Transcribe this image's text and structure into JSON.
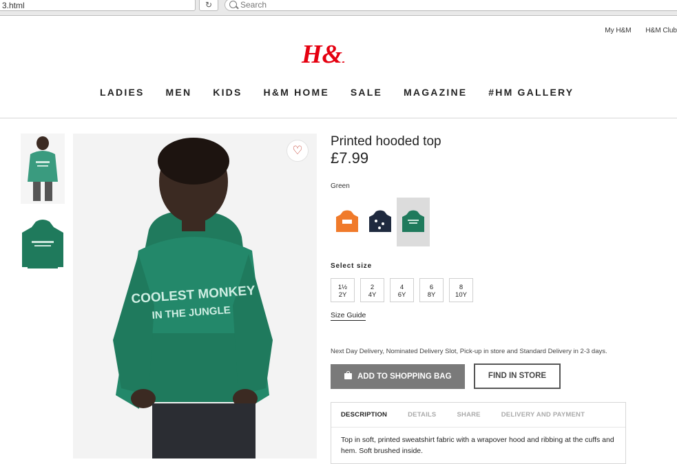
{
  "browser": {
    "url": "3.html",
    "search_placeholder": "Search",
    "reload_glyph": "↻"
  },
  "header": {
    "top_links": [
      "My H&M",
      "H&M Club"
    ],
    "brand": "H&M",
    "brand_color": "#e50010",
    "nav": [
      "LADIES",
      "MEN",
      "KIDS",
      "H&M HOME",
      "SALE",
      "MAGAZINE",
      "#HM GALLERY"
    ]
  },
  "product": {
    "title": "Printed hooded top",
    "price": "£7.99",
    "color_name": "Green",
    "print_text_line1": "COOLEST MONKEY",
    "print_text_line2": "IN THE JUNGLE",
    "swatches": [
      {
        "color": "#f07a2a",
        "selected": false
      },
      {
        "color": "#1f2a3f",
        "selected": false
      },
      {
        "color": "#1f7a5c",
        "selected": true
      }
    ],
    "size_label": "Select size",
    "sizes": [
      {
        "top": "1½",
        "bottom": "2Y"
      },
      {
        "top": "2",
        "bottom": "4Y"
      },
      {
        "top": "4",
        "bottom": "6Y"
      },
      {
        "top": "6",
        "bottom": "8Y"
      },
      {
        "top": "8",
        "bottom": "10Y"
      }
    ],
    "size_guide": "Size Guide",
    "delivery_note": "Next Day Delivery, Nominated Delivery Slot, Pick-up in store and Standard Delivery in 2-3 days.",
    "add_to_bag": "ADD TO SHOPPING BAG",
    "find_in_store": "FIND IN STORE",
    "tabs": [
      "DESCRIPTION",
      "DETAILS",
      "SHARE",
      "DELIVERY AND PAYMENT"
    ],
    "active_tab": "DESCRIPTION",
    "description": "Top in soft, printed sweatshirt fabric with a wrapover hood and ribbing at the cuffs and hem. Soft brushed inside."
  },
  "icons": {
    "favorite": "heart-icon",
    "bag": "shopping-bag-icon",
    "search": "search-icon",
    "reload": "reload-icon"
  }
}
